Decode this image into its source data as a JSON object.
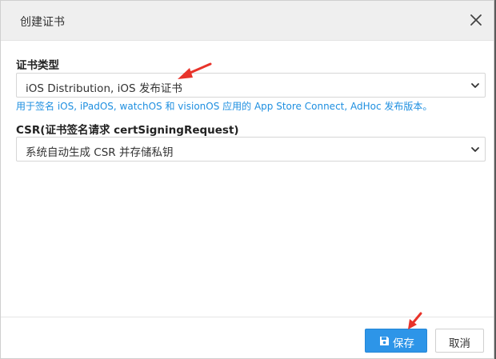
{
  "dialog": {
    "title": "创建证书",
    "close_icon": "close-icon"
  },
  "cert_type": {
    "label": "证书类型",
    "selected": "iOS Distribution, iOS 发布证书",
    "help": "用于签名 iOS, iPadOS, watchOS 和 visionOS 应用的 App Store Connect, AdHoc 发布版本。"
  },
  "csr": {
    "label": "CSR(证书签名请求 certSigningRequest)",
    "selected": "系统自动生成 CSR 并存储私钥"
  },
  "footer": {
    "save_label": "保存",
    "save_icon": "floppy-disk-icon",
    "cancel_label": "取消"
  },
  "colors": {
    "accent": "#2d95e8",
    "help_text": "#1e8fe0",
    "annotation_arrow": "#e8332a"
  }
}
